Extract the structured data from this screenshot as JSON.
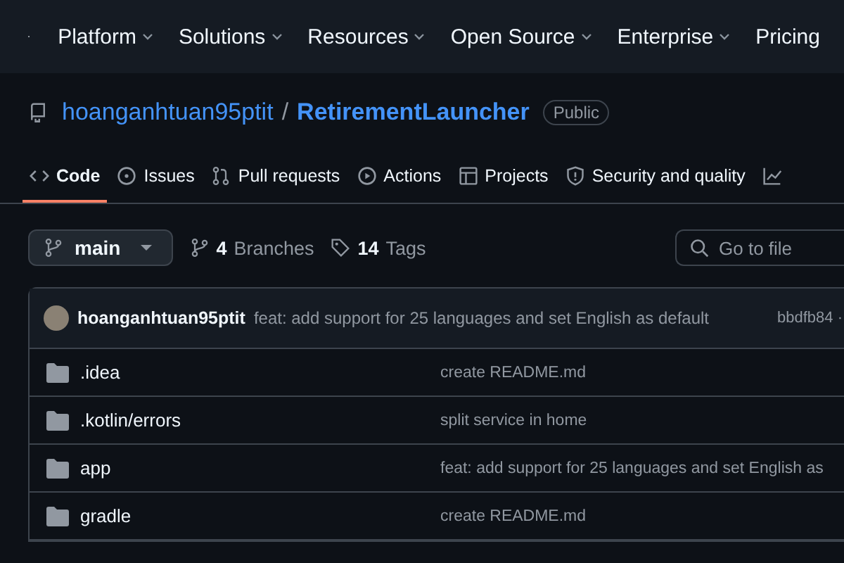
{
  "header": {
    "nav": [
      {
        "label": "Platform",
        "dropdown": true
      },
      {
        "label": "Solutions",
        "dropdown": true
      },
      {
        "label": "Resources",
        "dropdown": true
      },
      {
        "label": "Open Source",
        "dropdown": true
      },
      {
        "label": "Enterprise",
        "dropdown": true
      },
      {
        "label": "Pricing",
        "dropdown": false
      }
    ]
  },
  "repo": {
    "owner": "hoanganhtuan95ptit",
    "separator": "/",
    "name": "RetirementLauncher",
    "visibility": "Public"
  },
  "tabs": [
    {
      "label": "Code",
      "selected": true
    },
    {
      "label": "Issues",
      "selected": false
    },
    {
      "label": "Pull requests",
      "selected": false
    },
    {
      "label": "Actions",
      "selected": false
    },
    {
      "label": "Projects",
      "selected": false
    },
    {
      "label": "Security and quality",
      "selected": false
    },
    {
      "selected": false
    }
  ],
  "toolbar": {
    "branch": "main",
    "branches_count": "4",
    "branches_label": "Branches",
    "tags_count": "14",
    "tags_label": "Tags",
    "search": {
      "placeholder": "Go to file"
    }
  },
  "commit": {
    "author": "hoanganhtuan95ptit",
    "message": "feat: add support for 25 languages and set English as default",
    "hash": "bbdfb84 ·"
  },
  "files": [
    {
      "name": ".idea",
      "message": "create README.md"
    },
    {
      "name": ".kotlin/errors",
      "message": "split service in home"
    },
    {
      "name": "app",
      "message": "feat: add support for 25 languages and set English as"
    },
    {
      "name": "gradle",
      "message": "create README.md"
    }
  ]
}
